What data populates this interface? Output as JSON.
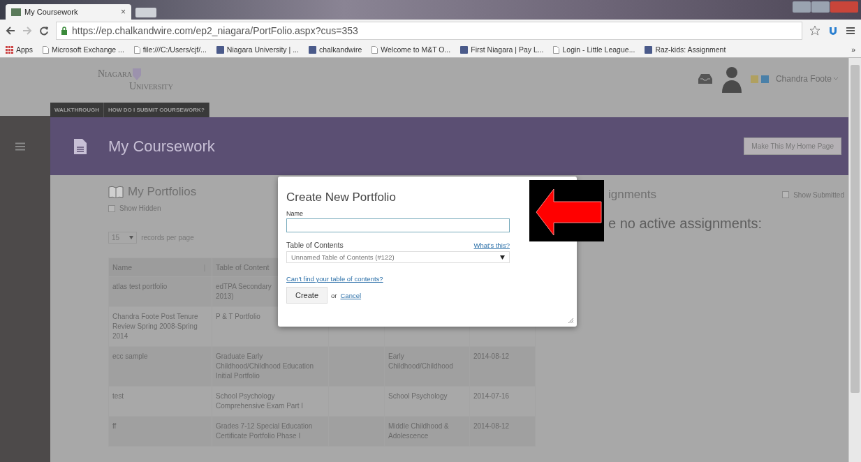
{
  "browser": {
    "tab": {
      "title": "My Coursework",
      "close": "×"
    },
    "url": "https://ep.chalkandwire.com/ep2_niagara/PortFolio.aspx?cus=353",
    "bookmarks": [
      {
        "label": "Apps",
        "kind": "apps"
      },
      {
        "label": "Microsoft Exchange ...",
        "kind": "page"
      },
      {
        "label": "file:///C:/Users/cjf/...",
        "kind": "page"
      },
      {
        "label": "Niagara University | ...",
        "kind": "site"
      },
      {
        "label": "chalkandwire",
        "kind": "site"
      },
      {
        "label": "Welcome to M&T O...",
        "kind": "page"
      },
      {
        "label": "First Niagara | Pay L...",
        "kind": "site"
      },
      {
        "label": "Login - Little League...",
        "kind": "page"
      },
      {
        "label": "Raz-kids: Assignment",
        "kind": "site"
      }
    ],
    "more": "»"
  },
  "header": {
    "logo": [
      "Niagara",
      "University"
    ],
    "user": "Chandra Foote",
    "links": [
      "WALKTHROUGH",
      "HOW DO I SUBMIT COURSEWORK?"
    ]
  },
  "page": {
    "title": "My Coursework",
    "home_button": "Make This My Home Page"
  },
  "portfolios": {
    "title": "My Portfolios",
    "show_hidden": {
      "label": "Show Hidden",
      "checked": false
    },
    "per_page": {
      "value": "15",
      "label": "records per page"
    },
    "columns": [
      "Name",
      "Table of Content"
    ],
    "rows": [
      {
        "name": "atlas test portfolio",
        "toc": "edTPA Secondary\n2013)"
      },
      {
        "name": "Chandra Foote Post Tenure Review Spring 2008-Spring 2014",
        "toc": "P & T Portfolio"
      },
      {
        "name": "ecc sample",
        "toc": "Graduate Early Childhood/Childhood Education Initial Portfolio",
        "column_4": "Early Childhood/Childhood",
        "column_5": "2014-08-12"
      },
      {
        "name": "test",
        "toc": "School Psychology Comprehensive Exam Part I",
        "column_4": "School Psychology",
        "column_5": "2014-07-16"
      },
      {
        "name": "ff",
        "toc": "Grades 7-12 Special Education Certificate Portfolio Phase I",
        "column_4": "Middle Childhood & Adolescence",
        "column_5": "2014-08-12"
      }
    ]
  },
  "assignments": {
    "title": "ignments",
    "show_submitted": {
      "label": "Show Submitted",
      "checked": false
    },
    "message": "e no active assignments:"
  },
  "dialog": {
    "title": "Create New Portfolio",
    "name_label": "Name",
    "toc_label": "Table of Contents",
    "help_link": "What's this?",
    "toc_value": "Unnamed Table of Contents (#122)",
    "find_link": "Can't find your table of contents?",
    "create": "Create",
    "or": "or",
    "cancel": "Cancel"
  }
}
